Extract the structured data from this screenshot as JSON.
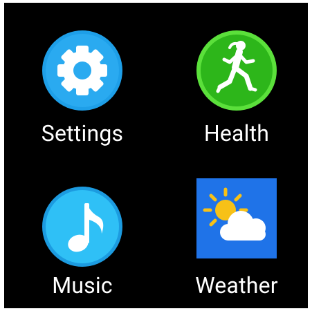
{
  "apps": [
    {
      "id": "settings",
      "label": "Settings",
      "icon": "gear-icon",
      "color": "#1E9FE8"
    },
    {
      "id": "health",
      "label": "Health",
      "icon": "runner-icon",
      "color": "#36C81E"
    },
    {
      "id": "music",
      "label": "Music",
      "icon": "music-note-icon",
      "color": "#29B7F0"
    },
    {
      "id": "weather",
      "label": "Weather",
      "icon": "sun-cloud-icon",
      "color": "#1F73E8"
    }
  ]
}
